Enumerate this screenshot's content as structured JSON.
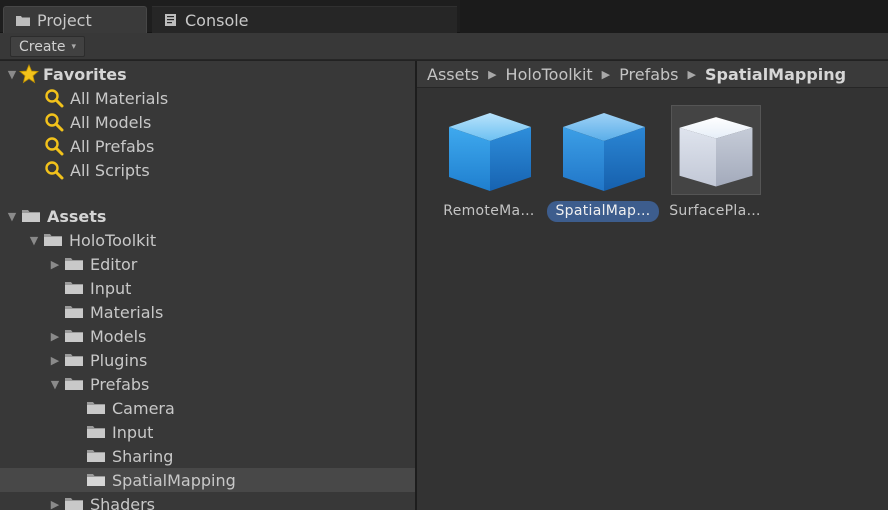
{
  "tabs": [
    {
      "label": "Project",
      "icon": "folder-icon",
      "active": true
    },
    {
      "label": "Console",
      "icon": "console-icon",
      "active": false
    }
  ],
  "toolbar": {
    "create_label": "Create",
    "create_caret": "▾"
  },
  "tree": {
    "favorites": {
      "label": "Favorites",
      "items": [
        "All Materials",
        "All Models",
        "All Prefabs",
        "All Scripts"
      ]
    },
    "assets": {
      "label": "Assets",
      "holotoolkit": "HoloToolkit",
      "children": [
        "Editor",
        "Input",
        "Materials",
        "Models",
        "Plugins",
        "Prefabs"
      ],
      "prefab_children": [
        "Camera",
        "Input",
        "Sharing",
        "SpatialMapping"
      ],
      "after": "Shaders"
    }
  },
  "breadcrumb": [
    "Assets",
    "HoloToolkit",
    "Prefabs",
    "SpatialMapping"
  ],
  "breadcrumb_sep": "▶",
  "assets": [
    {
      "name": "RemoteMa…",
      "icon": "blue-cube-icon",
      "selected": false
    },
    {
      "name": "SpatialMap…",
      "icon": "blue-cube-icon",
      "selected": true
    },
    {
      "name": "SurfacePla…",
      "icon": "white-cube-icon",
      "selected": false
    }
  ],
  "colors": {
    "panel_bg": "#383838",
    "selection": "#3d5d8d",
    "cube_blue": "#3d9ee6",
    "star": "#f2c21b"
  }
}
